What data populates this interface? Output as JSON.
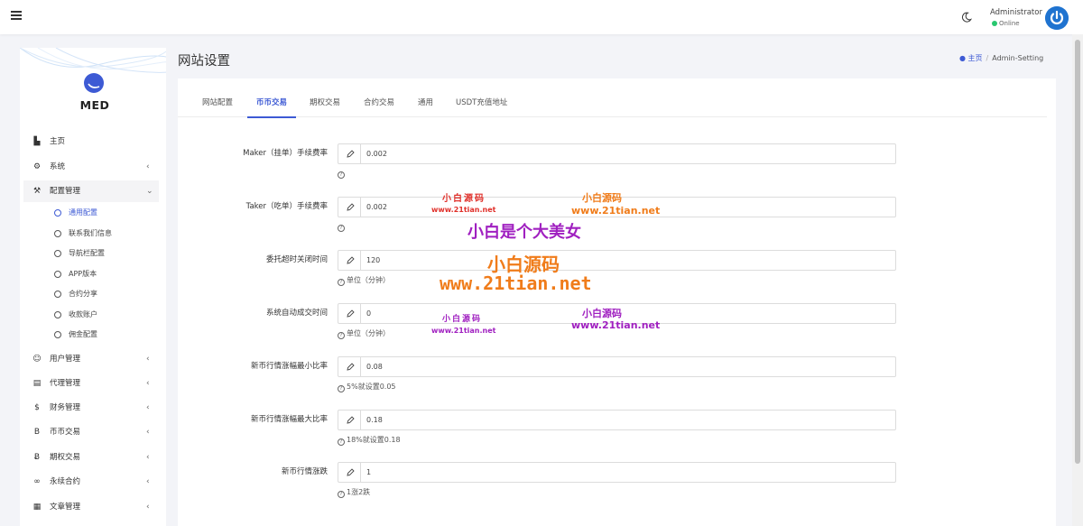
{
  "topbar": {
    "user_name": "Administrator",
    "user_status": "Online"
  },
  "sidebar": {
    "logo_text": "MED",
    "items": [
      {
        "label": "主页",
        "icon": "bar-chart-icon",
        "glyph": "▙"
      },
      {
        "label": "系统",
        "icon": "gear-icon",
        "glyph": "⚙",
        "chevron": "‹"
      },
      {
        "label": "配置管理",
        "icon": "wrench-icon",
        "glyph": "⚒",
        "chevron": "⌵"
      },
      {
        "label": "用户管理",
        "icon": "users-icon",
        "glyph": "☺",
        "chevron": "‹"
      },
      {
        "label": "代理管理",
        "icon": "id-card-icon",
        "glyph": "▤",
        "chevron": "‹"
      },
      {
        "label": "财务管理",
        "icon": "dollar-icon",
        "glyph": "$",
        "chevron": "‹"
      },
      {
        "label": "币币交易",
        "icon": "bitcoin-icon",
        "glyph": "B",
        "chevron": "‹"
      },
      {
        "label": "期权交易",
        "icon": "bitcoin-icon",
        "glyph": "Ƀ",
        "chevron": "‹"
      },
      {
        "label": "永续合约",
        "icon": "link-icon",
        "glyph": "∞",
        "chevron": "‹"
      },
      {
        "label": "文章管理",
        "icon": "newspaper-icon",
        "glyph": "▦",
        "chevron": "‹"
      }
    ],
    "sub_items": [
      "通用配置",
      "联系我们信息",
      "导航栏配置",
      "APP版本",
      "合约分享",
      "收款账户",
      "佣金配置"
    ]
  },
  "header": {
    "title": "网站设置",
    "breadcrumb_home": "主页",
    "breadcrumb_current": "Admin-Setting"
  },
  "tabs": [
    "网站配置",
    "币币交易",
    "期权交易",
    "合约交易",
    "通用",
    "USDT充值地址"
  ],
  "form": [
    {
      "label": "Maker（挂单）手续费率",
      "value": "0.002",
      "help": ""
    },
    {
      "label": "Taker（吃单）手续费率",
      "value": "0.002",
      "help": ""
    },
    {
      "label": "委托超时关闭时间",
      "value": "120",
      "help": "单位（分钟）"
    },
    {
      "label": "系统自动成交时间",
      "value": "0",
      "help": "单位（分钟）"
    },
    {
      "label": "新币行情涨幅最小比率",
      "value": "0.08",
      "help": "5%就设置0.05"
    },
    {
      "label": "新币行情涨幅最大比率",
      "value": "0.18",
      "help": "18%就设置0.18"
    },
    {
      "label": "新币行情涨跌",
      "value": "1",
      "help": "1涨2跌"
    }
  ],
  "help_glyph": "?",
  "watermarks": {
    "small_cn": "小白源码",
    "url": "www.21tian.net",
    "slogan": "小白是个大美女",
    "big_cn": "小白源码"
  },
  "colors": {
    "accent": "#3d5ad4",
    "online": "#28c76f",
    "power": "#1f73d0"
  }
}
